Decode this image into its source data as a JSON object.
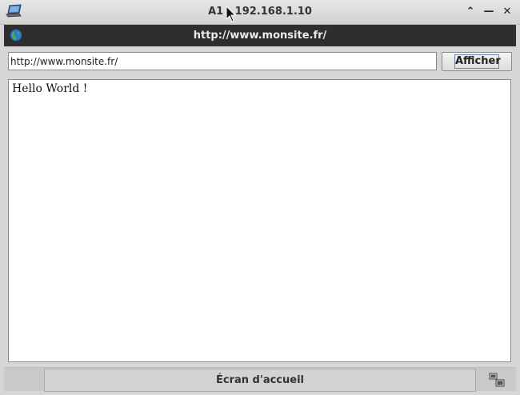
{
  "window": {
    "title": "A1 - 192.168.1.10",
    "app_icon": "laptop-icon",
    "buttons": [
      "chevron-up-icon",
      "minimize-icon",
      "close-icon"
    ]
  },
  "browser": {
    "header_title": "http://www.monsite.fr/",
    "header_icon": "globe-icon",
    "address_value": "http://www.monsite.fr/",
    "show_button_label": "Afficher",
    "page_content": "Hello World !"
  },
  "footer": {
    "home_button_label": "Écran d'accueil",
    "right_icon": "screens-icon"
  },
  "colors": {
    "header_bg": "#2e2e2e",
    "header_text": "#eaeaea",
    "window_bg": "#d6d6d6"
  }
}
